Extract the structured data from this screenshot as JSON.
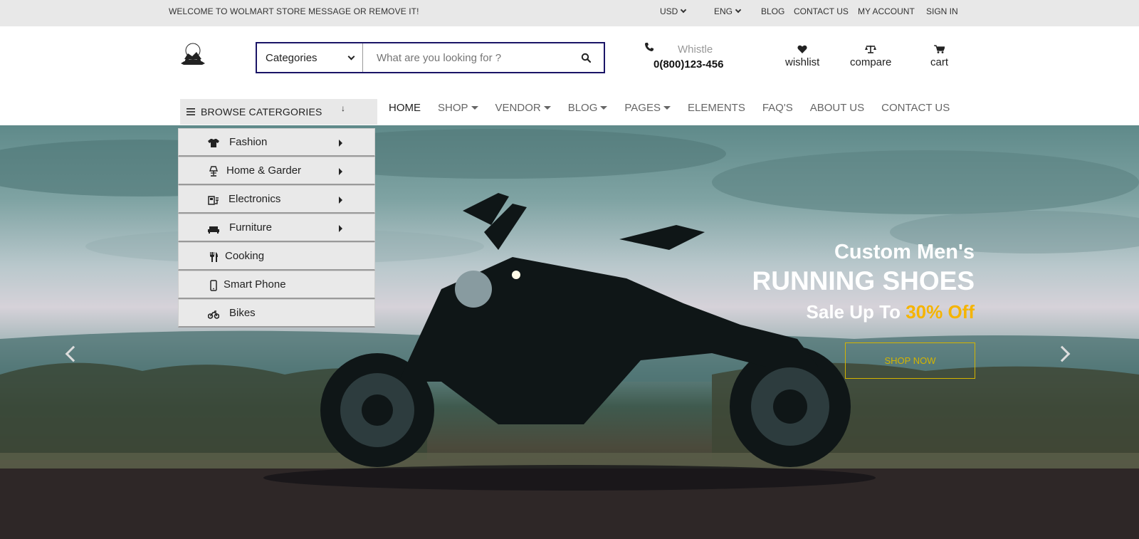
{
  "topbar": {
    "welcome": "WELCOME TO WOLMART STORE MESSAGE OR REMOVE IT!",
    "currency": "USD",
    "language": "ENG",
    "links": [
      "BLOG",
      "CONTACT US",
      "MY ACCOUNT",
      "SIGN IN"
    ]
  },
  "header": {
    "search": {
      "category_label": "Categories",
      "placeholder": "What are you looking for ?",
      "value": ""
    },
    "contact": {
      "label": "Whistle",
      "phone": "0(800)123-456"
    },
    "actions": {
      "wishlist": "wishlist",
      "compare": "compare",
      "cart": "cart"
    }
  },
  "nav": {
    "browse_label": "BROWSE CATERGORIES",
    "items": [
      "HOME",
      "SHOP",
      "VENDOR",
      "BLOG",
      "PAGES",
      "ELEMENTS",
      "FAQ'S",
      "ABOUT US",
      "CONTACT US"
    ]
  },
  "categories": [
    {
      "label": "Fashion",
      "icon": "tshirt-icon",
      "has_sub": true
    },
    {
      "label": "Home & Garder",
      "icon": "lamp-icon",
      "has_sub": true
    },
    {
      "label": "Electronics",
      "icon": "plug-icon",
      "has_sub": true
    },
    {
      "label": "Furniture",
      "icon": "couch-icon",
      "has_sub": true
    },
    {
      "label": "Cooking",
      "icon": "utensils-icon",
      "has_sub": false
    },
    {
      "label": "Smart Phone",
      "icon": "phone-icon",
      "has_sub": false
    },
    {
      "label": "Bikes",
      "icon": "motorcycle-icon",
      "has_sub": false
    }
  ],
  "hero": {
    "line1": "Custom Men's",
    "line2": "RUNNING SHOES",
    "line3_prefix": "Sale Up To ",
    "line3_highlight": "30% Off",
    "button": "SHOP NOW",
    "highlight_color": "#f5b400"
  }
}
